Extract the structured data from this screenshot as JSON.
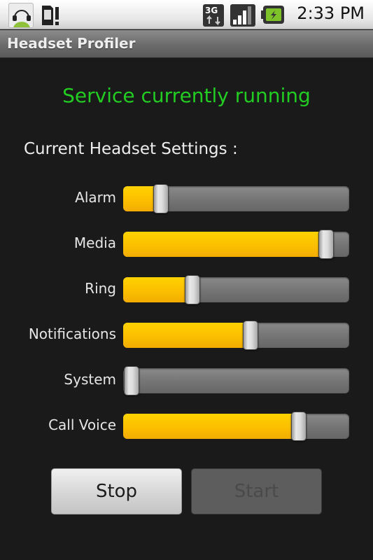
{
  "status_bar": {
    "notification_icons": [
      "headset-app-icon",
      "sim-alert-icon"
    ],
    "system_icons": [
      "3g-data-icon",
      "signal-strength-icon",
      "battery-charging-icon"
    ],
    "time": "2:33 PM"
  },
  "app": {
    "title": "Headset Profiler"
  },
  "main": {
    "service_status": "Service currently running",
    "service_status_color": "#22cc22",
    "settings_heading": "Current Headset Settings :",
    "sliders": [
      {
        "label": "Alarm",
        "value_percent": 14
      },
      {
        "label": "Media",
        "value_percent": 93
      },
      {
        "label": "Ring",
        "value_percent": 29
      },
      {
        "label": "Notifications",
        "value_percent": 57
      },
      {
        "label": "System",
        "value_percent": 0
      },
      {
        "label": "Call Voice",
        "value_percent": 80
      }
    ],
    "accent_color": "#fbbd00"
  },
  "buttons": {
    "stop_label": "Stop",
    "start_label": "Start",
    "start_enabled": false
  }
}
